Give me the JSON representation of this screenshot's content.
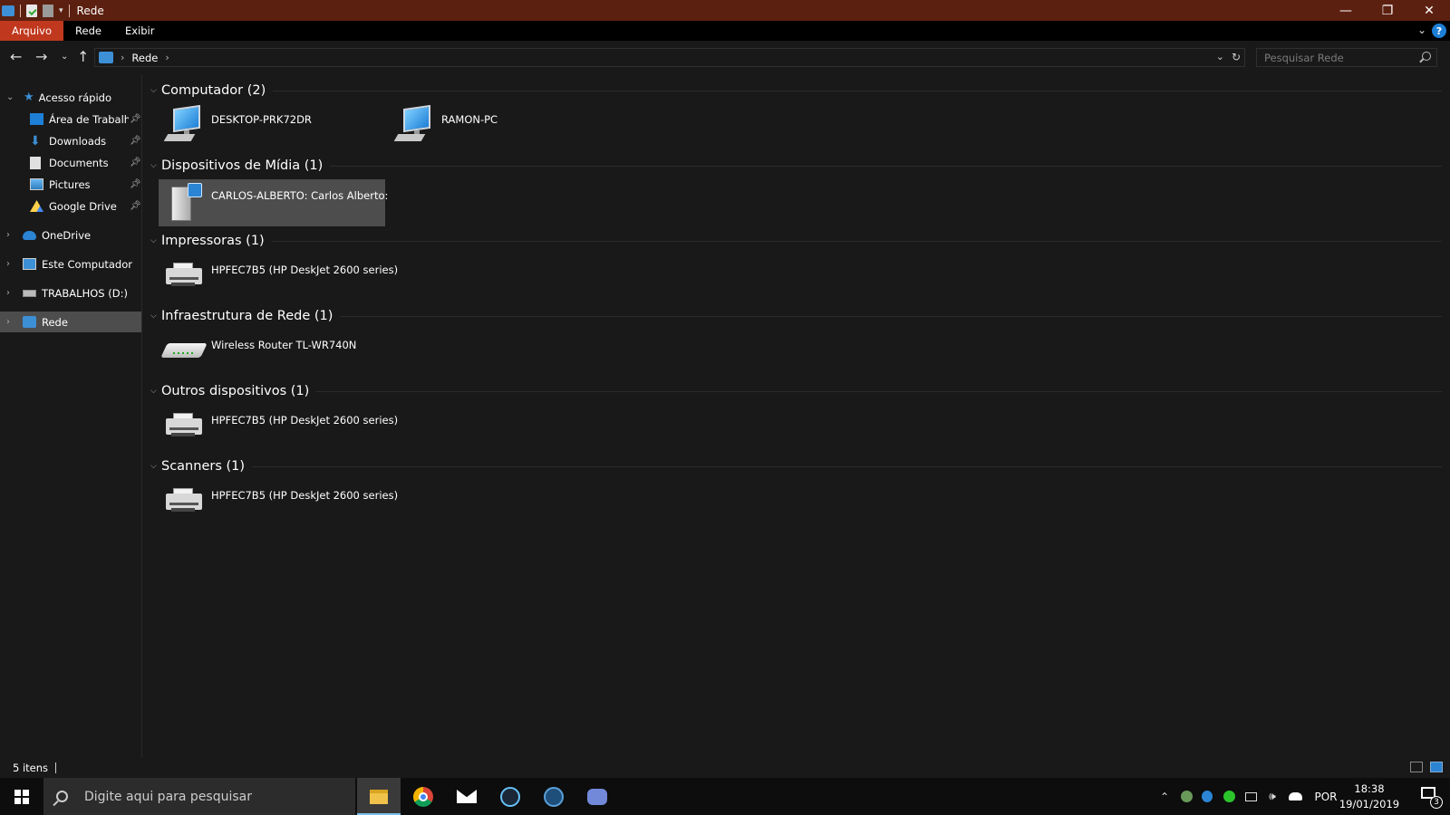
{
  "window": {
    "title": "Rede",
    "controls": [
      "minimize",
      "restore",
      "close"
    ]
  },
  "ribbon": {
    "tabs": [
      {
        "label": "Arquivo",
        "active": true
      },
      {
        "label": "Rede",
        "active": false
      },
      {
        "label": "Exibir",
        "active": false
      }
    ],
    "accent_color": "#c0381e"
  },
  "address": {
    "path": [
      "Rede"
    ],
    "search_placeholder": "Pesquisar Rede"
  },
  "sidebar": {
    "items": [
      {
        "label": "Acesso rápido",
        "icon": "star-icon",
        "expanded": true
      },
      {
        "label": "Área de Trabalho",
        "icon": "desktop-icon",
        "pinned": true
      },
      {
        "label": "Downloads",
        "icon": "download-icon",
        "pinned": true
      },
      {
        "label": "Documents",
        "icon": "document-icon",
        "pinned": true
      },
      {
        "label": "Pictures",
        "icon": "pictures-icon",
        "pinned": true
      },
      {
        "label": "Google Drive",
        "icon": "google-drive-icon",
        "pinned": true
      },
      {
        "label": "OneDrive",
        "icon": "cloud-icon"
      },
      {
        "label": "Este Computador",
        "icon": "computer-icon"
      },
      {
        "label": "TRABALHOS (D:)",
        "icon": "drive-icon"
      },
      {
        "label": "Rede",
        "icon": "network-icon",
        "selected": true
      }
    ]
  },
  "groups": [
    {
      "title": "Computador (2)",
      "items": [
        {
          "label": "DESKTOP-PRK72DR",
          "icon": "computer-icon"
        },
        {
          "label": "RAMON-PC",
          "icon": "computer-icon"
        }
      ]
    },
    {
      "title": "Dispositivos de Mídia (1)",
      "items": [
        {
          "label": "CARLOS-ALBERTO: Carlos Alberto:",
          "icon": "media-server-icon",
          "selected": true
        }
      ]
    },
    {
      "title": "Impressoras (1)",
      "items": [
        {
          "label": "HPFEC7B5 (HP DeskJet 2600 series)",
          "icon": "printer-icon"
        }
      ]
    },
    {
      "title": "Infraestrutura de Rede (1)",
      "items": [
        {
          "label": "Wireless Router TL-WR740N",
          "icon": "router-icon"
        }
      ]
    },
    {
      "title": "Outros dispositivos (1)",
      "items": [
        {
          "label": "HPFEC7B5 (HP DeskJet 2600 series)",
          "icon": "printer-icon"
        }
      ]
    },
    {
      "title": "Scanners (1)",
      "items": [
        {
          "label": "HPFEC7B5 (HP DeskJet 2600 series)",
          "icon": "printer-icon"
        }
      ]
    }
  ],
  "status": {
    "item_count": "5 itens"
  },
  "taskbar": {
    "search_placeholder": "Digite aqui para pesquisar",
    "apps": [
      "file-explorer-icon",
      "chrome-icon",
      "mail-icon",
      "steam-icon",
      "headset-icon",
      "discord-icon"
    ],
    "language": "POR",
    "time": "18:38",
    "date": "19/01/2019",
    "notification_count": "3"
  }
}
